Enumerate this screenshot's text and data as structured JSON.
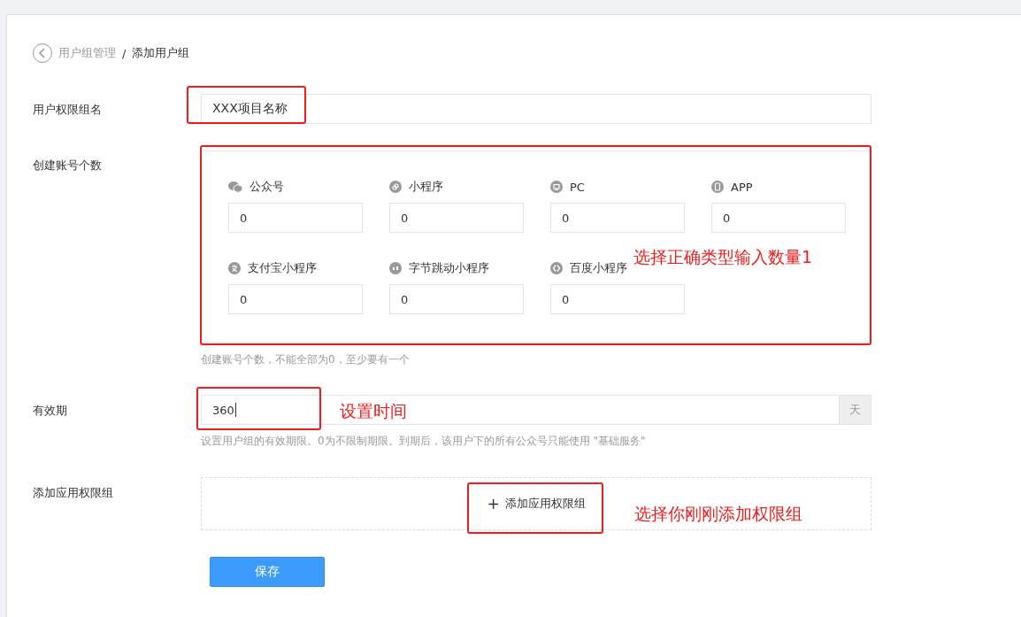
{
  "breadcrumb": {
    "parent": "用户组管理",
    "separator": "/",
    "current": "添加用户组"
  },
  "group_name": {
    "label": "用户权限组名",
    "value": "XXX项目名称"
  },
  "accounts": {
    "label": "创建账号个数",
    "hint": "创建账号个数，不能全部为0，至少要有一个",
    "types": [
      {
        "kind": "wechat",
        "label": "公众号",
        "value": "0"
      },
      {
        "kind": "miniprogram",
        "label": "小程序",
        "value": "0"
      },
      {
        "kind": "pc",
        "label": "PC",
        "value": "0"
      },
      {
        "kind": "app",
        "label": "APP",
        "value": "0"
      },
      {
        "kind": "alipay",
        "label": "支付宝小程序",
        "value": "0"
      },
      {
        "kind": "bytedance",
        "label": "字节跳动小程序",
        "value": "0"
      },
      {
        "kind": "baidu",
        "label": "百度小程序",
        "value": "0"
      }
    ]
  },
  "validity": {
    "label": "有效期",
    "value": "360",
    "unit": "天",
    "hint": "设置用户组的有效期限。0为不限制期限。到期后，该用户下的所有公众号只能使用 \"基础服务\""
  },
  "app_groups": {
    "label": "添加应用权限组",
    "plus": "+",
    "button": "添加应用权限组"
  },
  "save_button": "保存",
  "annotations": [
    "选择正确类型输入数量1",
    "设置时间",
    "选择你刚刚添加权限组"
  ]
}
